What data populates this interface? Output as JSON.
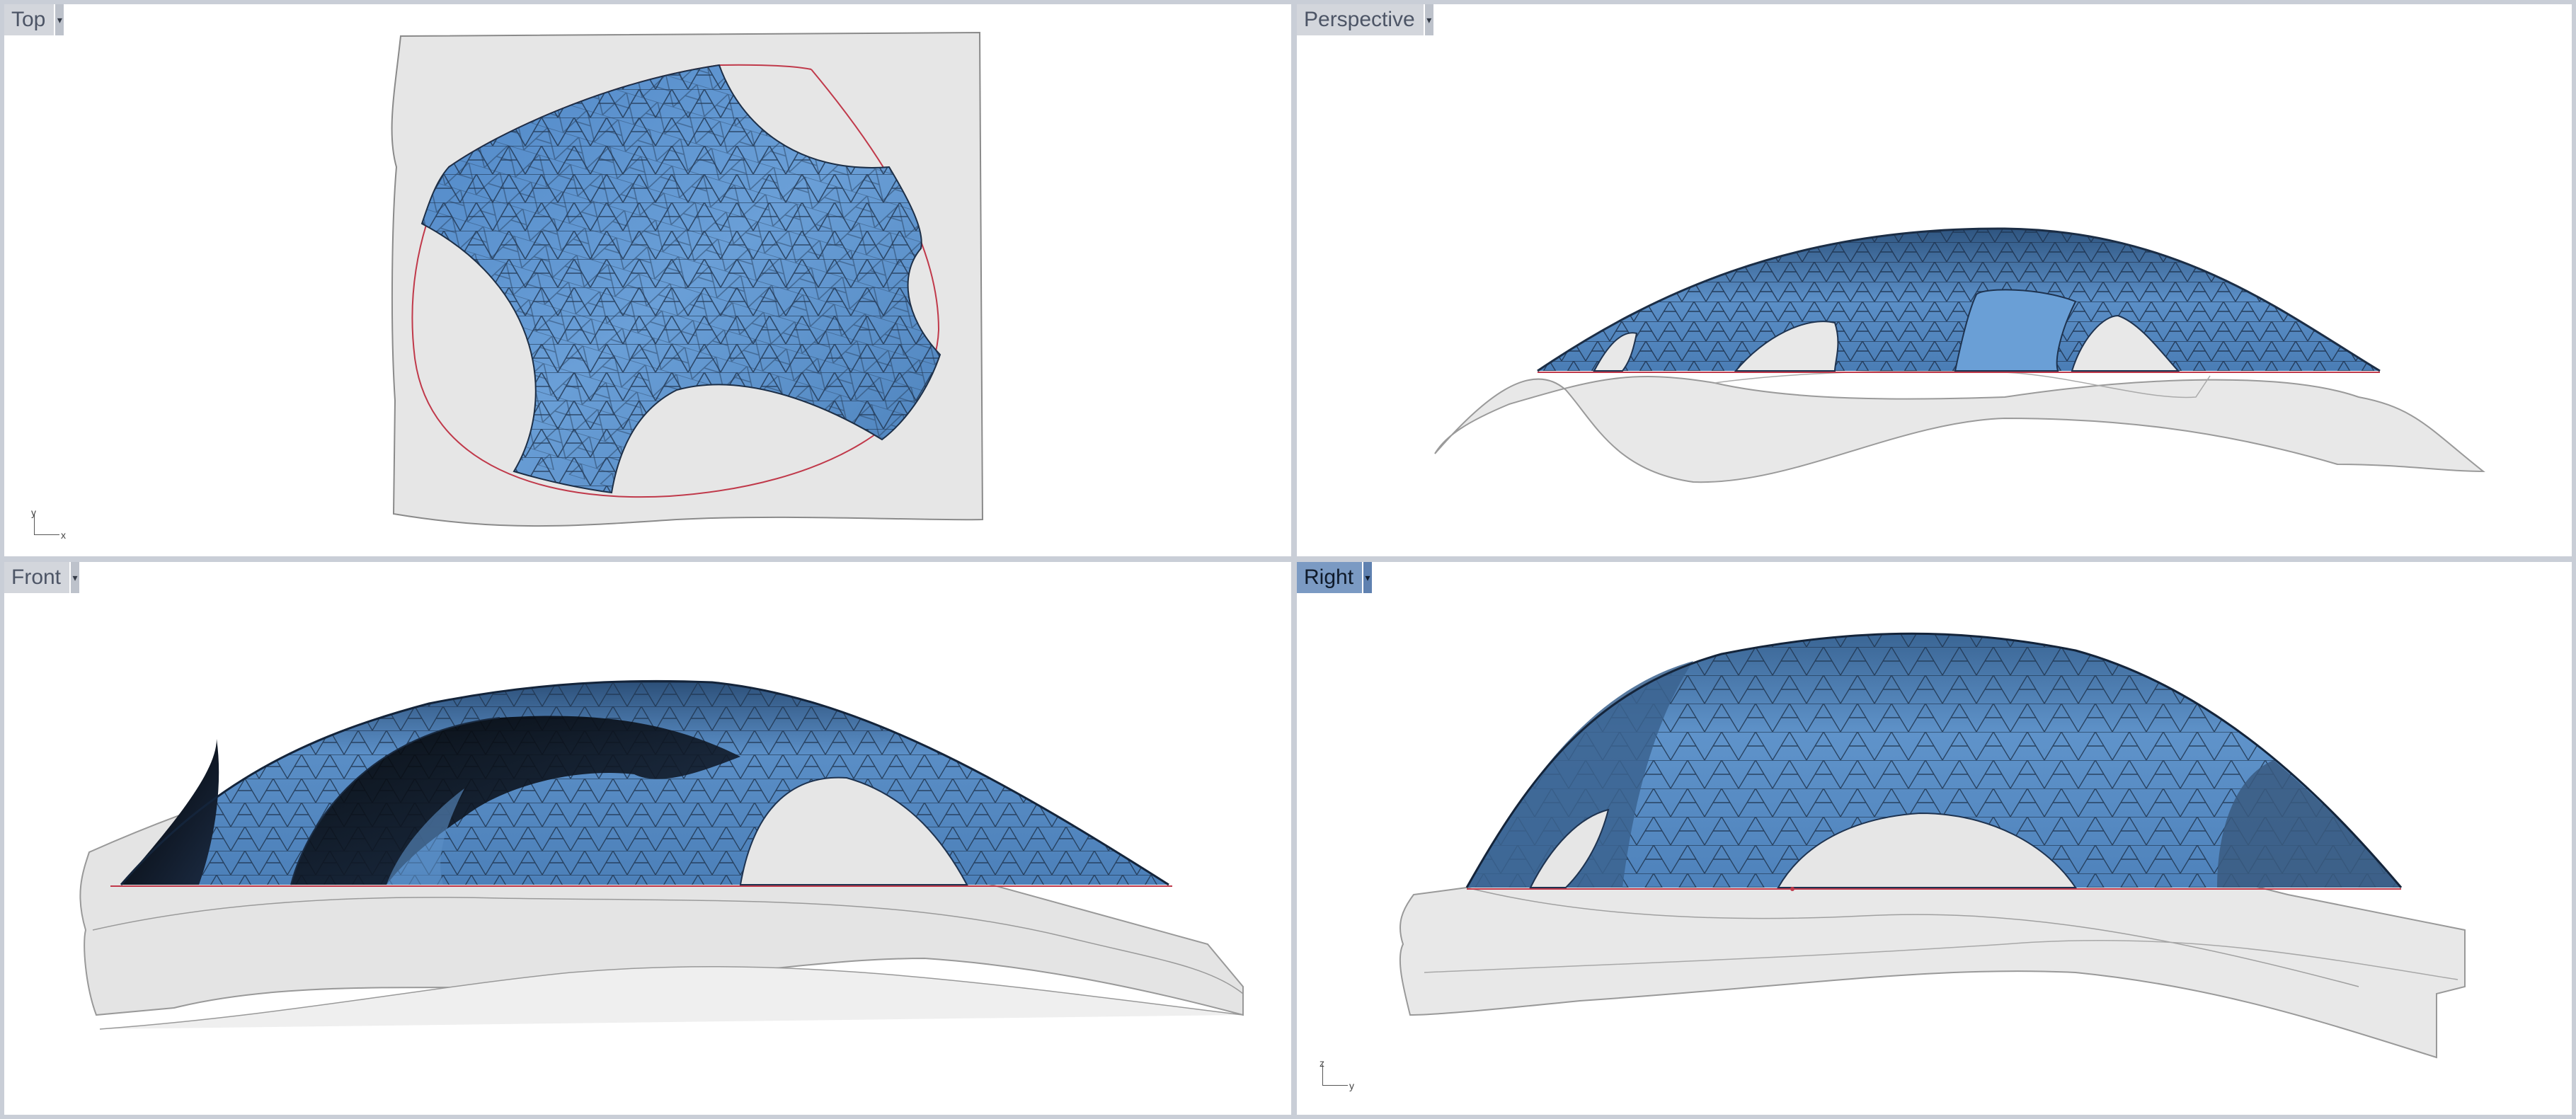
{
  "viewports": {
    "top": {
      "label": "Top",
      "menu_arrow": "▾",
      "axes": {
        "horizontal": "x",
        "vertical": "y"
      }
    },
    "perspective": {
      "label": "Perspective",
      "menu_arrow": "▾"
    },
    "front": {
      "label": "Front",
      "menu_arrow": "▾"
    },
    "right": {
      "label": "Right",
      "menu_arrow": "▾",
      "active": true,
      "axes": {
        "horizontal": "y",
        "vertical": "z"
      }
    }
  },
  "colors": {
    "shell_blue": "#5b8fc7",
    "shell_dark": "#1e3350",
    "ground_gray": "#e5e5e5",
    "boundary_red": "#c0394a",
    "active_tab": "#7b9ac3",
    "frame": "#c9ced7"
  },
  "icons": {
    "viewport_menu": "chevron-down-icon",
    "axis_indicator": "axis-icon"
  }
}
